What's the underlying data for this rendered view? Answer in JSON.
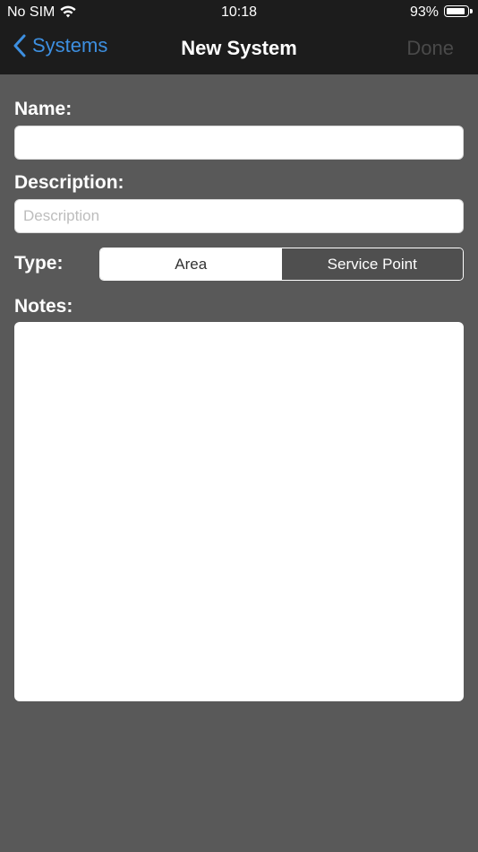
{
  "status_bar": {
    "carrier": "No SIM",
    "time": "10:18",
    "battery_percent": "93%",
    "battery_level": 0.93,
    "wifi_icon": "wifi-icon"
  },
  "nav": {
    "back_label": "Systems",
    "back_icon": "chevron-left-icon",
    "title": "New System",
    "done_label": "Done",
    "done_enabled": false
  },
  "form": {
    "name_label": "Name:",
    "name_value": "",
    "description_label": "Description:",
    "description_placeholder": "Description",
    "description_value": "",
    "type_label": "Type:",
    "type_options": [
      "Area",
      "Service Point"
    ],
    "type_selected": "Area",
    "notes_label": "Notes:",
    "notes_value": ""
  },
  "colors": {
    "accent": "#3d8fe0",
    "background": "#595959",
    "bar": "#1c1c1c",
    "disabled": "#4a4a4a"
  }
}
